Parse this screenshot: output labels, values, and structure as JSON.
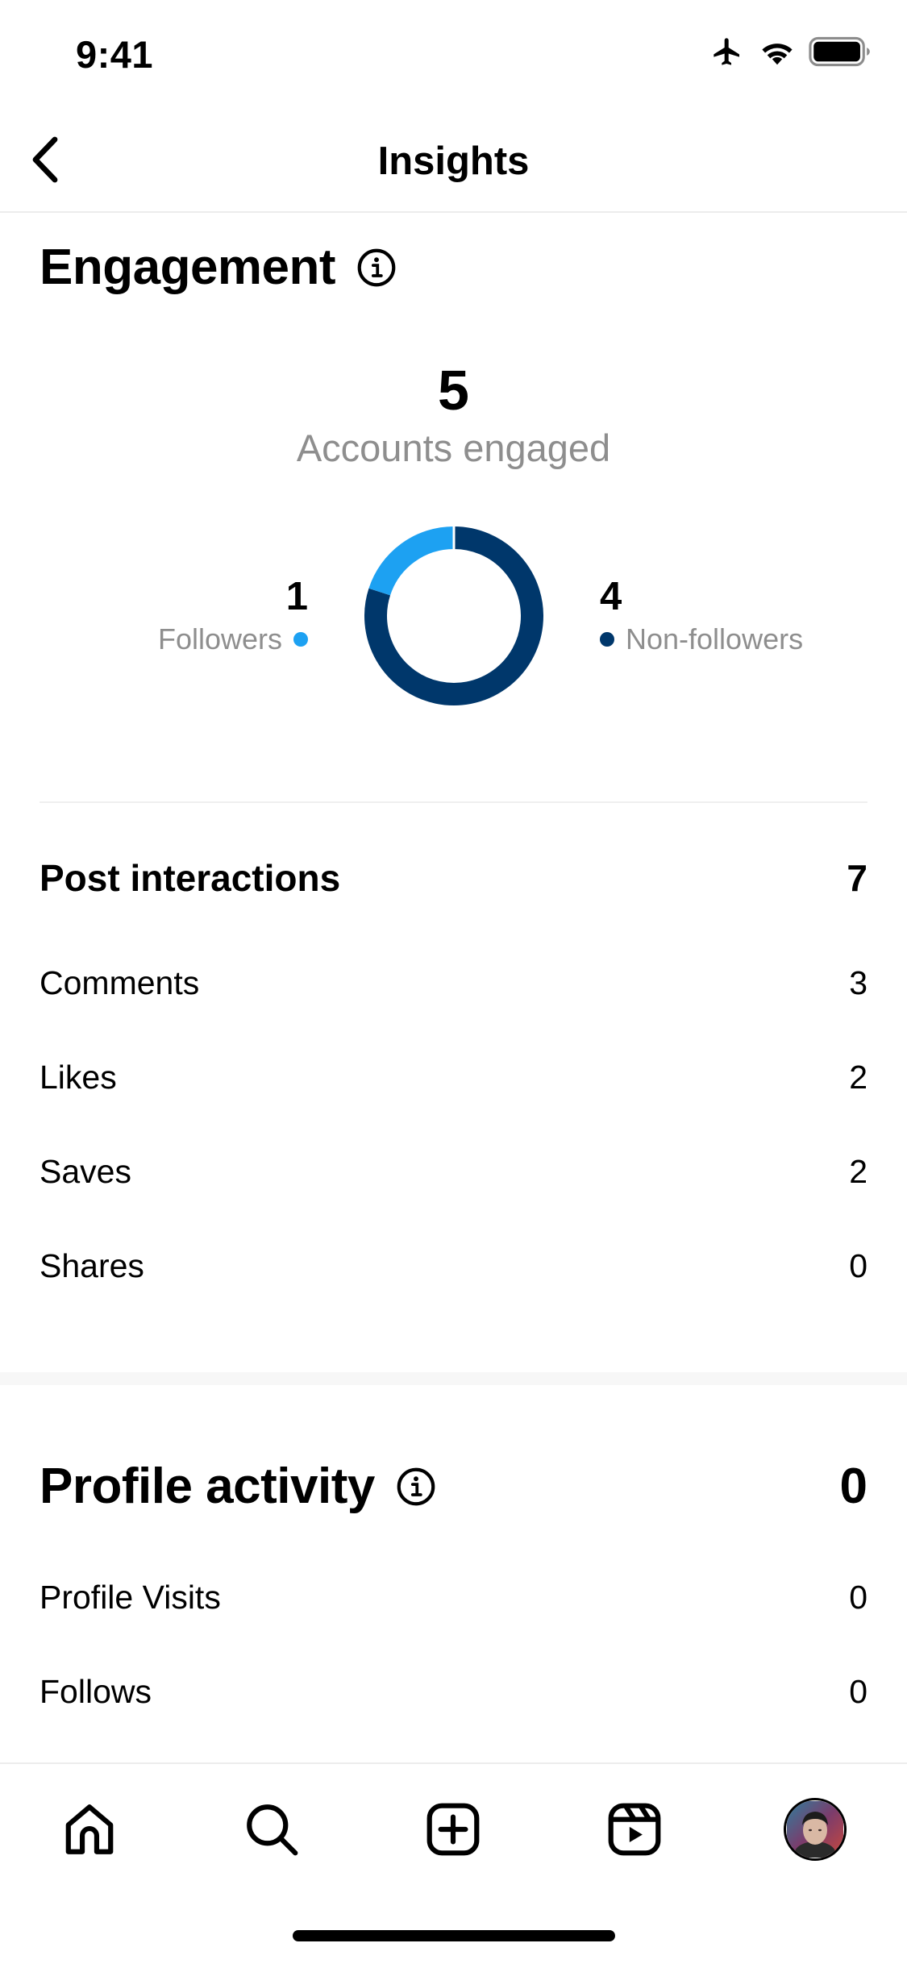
{
  "status_bar": {
    "time": "9:41"
  },
  "nav": {
    "title": "Insights"
  },
  "engagement": {
    "heading": "Engagement",
    "total": "5",
    "caption": "Accounts engaged",
    "followers_count": "1",
    "followers_label": "Followers",
    "non_followers_count": "4",
    "non_followers_label": "Non-followers"
  },
  "chart_data": {
    "type": "pie",
    "categories": [
      "Followers",
      "Non-followers"
    ],
    "values": [
      1,
      4
    ],
    "colors": [
      "#1da1f2",
      "#00376b"
    ]
  },
  "post_interactions": {
    "label": "Post interactions",
    "total": "7",
    "rows": [
      {
        "label": "Comments",
        "value": "3"
      },
      {
        "label": "Likes",
        "value": "2"
      },
      {
        "label": "Saves",
        "value": "2"
      },
      {
        "label": "Shares",
        "value": "0"
      }
    ]
  },
  "profile_activity": {
    "heading": "Profile activity",
    "total": "0",
    "rows": [
      {
        "label": "Profile Visits",
        "value": "0"
      },
      {
        "label": "Follows",
        "value": "0"
      }
    ]
  },
  "tab_bar": {
    "items": [
      "home-icon",
      "search-icon",
      "create-icon",
      "reels-icon",
      "profile-avatar"
    ]
  },
  "colors": {
    "followers_dot": "#1da1f2",
    "non_followers_dot": "#00376b",
    "caption_gray": "#8e8e8e"
  }
}
